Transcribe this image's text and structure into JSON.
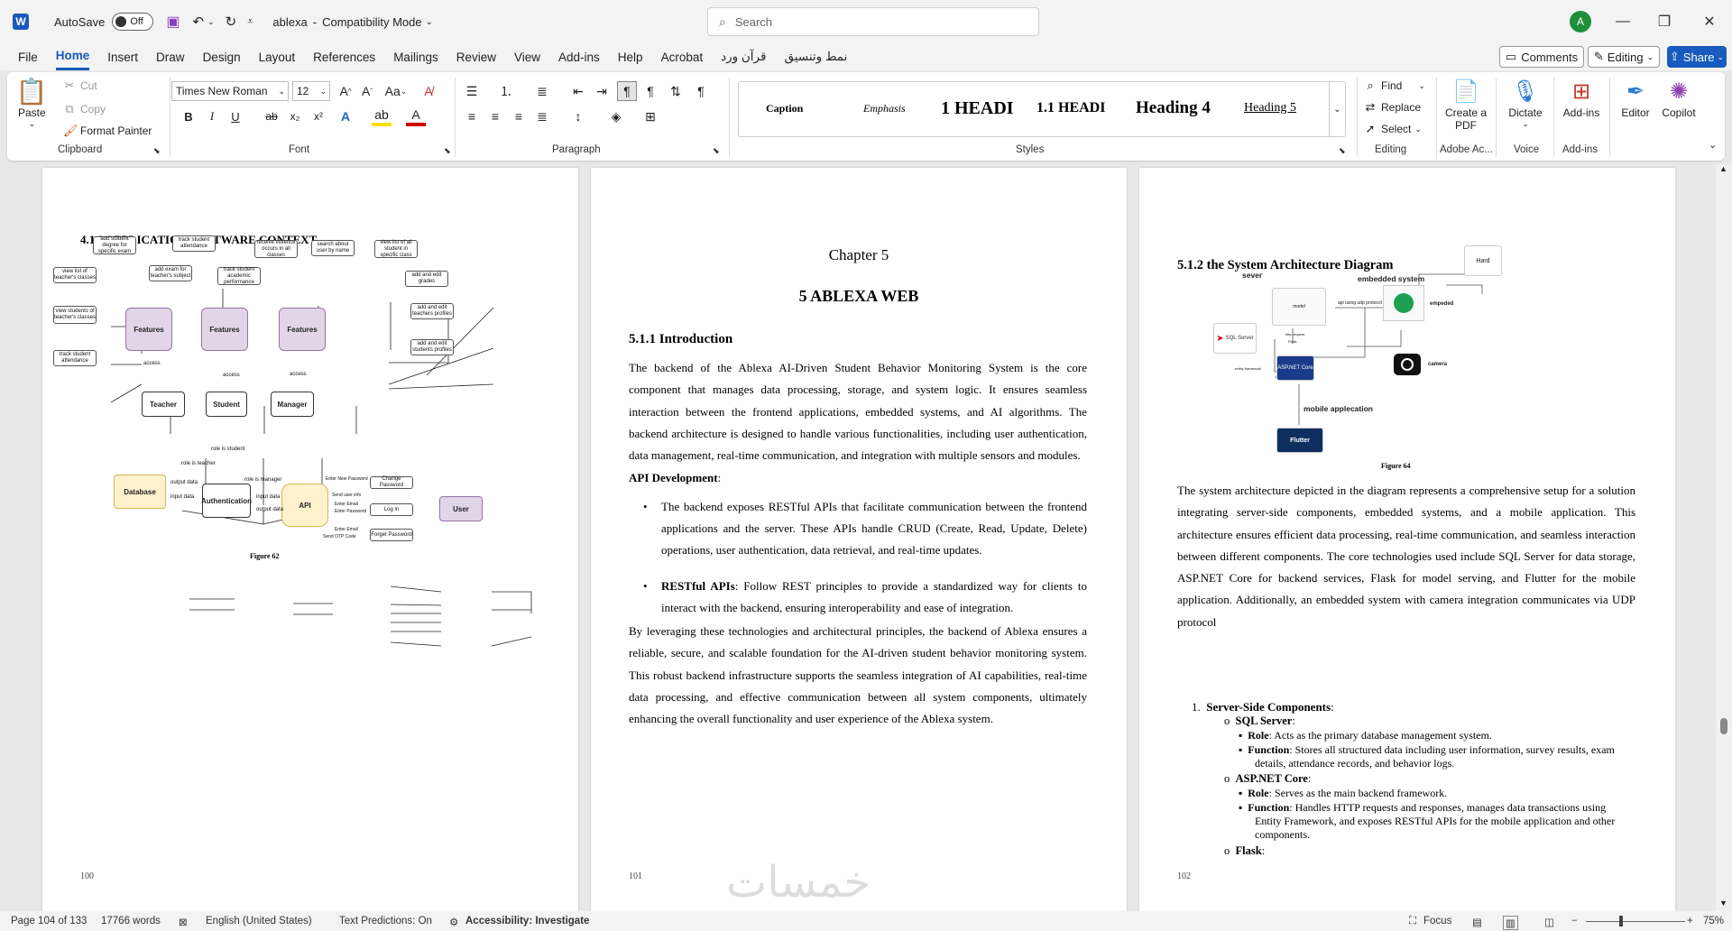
{
  "titlebar": {
    "autosave_label": "AutoSave",
    "autosave_state": "Off",
    "doc_title": "ablexa",
    "mode": "Compatibility Mode",
    "search_placeholder": "Search",
    "user_initial": "A"
  },
  "menu": [
    "File",
    "Home",
    "Insert",
    "Draw",
    "Design",
    "Layout",
    "References",
    "Mailings",
    "Review",
    "View",
    "Add-ins",
    "Help",
    "Acrobat",
    "قرآن ورد",
    "نمط وتنسيق"
  ],
  "actions": {
    "comments": "Comments",
    "editing": "Editing",
    "share": "Share"
  },
  "ribbon": {
    "clipboard": {
      "paste": "Paste",
      "cut": "Cut",
      "copy": "Copy",
      "format_painter": "Format Painter",
      "label": "Clipboard"
    },
    "font": {
      "name": "Times New Roman",
      "size": "12",
      "label": "Font",
      "case": "Aa"
    },
    "paragraph": {
      "label": "Paragraph"
    },
    "styles": {
      "items": [
        "Caption",
        "Emphasis",
        "1  HEADI",
        "1.1  HEADI",
        "Heading 4",
        "Heading 5"
      ],
      "label": "Styles"
    },
    "editing": {
      "find": "Find",
      "replace": "Replace",
      "select": "Select",
      "label": "Editing"
    },
    "adobe": {
      "btn": "Create a PDF",
      "label": "Adobe Ac..."
    },
    "voice": {
      "btn": "Dictate",
      "label": "Voice"
    },
    "addins": {
      "btn": "Add-ins",
      "label": "Add-ins"
    },
    "editor": "Editor",
    "copilot": "Copilot"
  },
  "page1": {
    "heading": "4.1.9 APPLICATION SOFTWARE CONTEXT",
    "caption": "Figure 62",
    "page_number": "100",
    "diagram": {
      "features": "Features",
      "access": "access",
      "teacher": "Teacher",
      "student": "Student",
      "manager": "Manager",
      "database": "Database",
      "auth": "Authentication",
      "api": "API",
      "user": "User",
      "b_add_student_degree": "add  student degree for specific exam",
      "b_track_att1": "track student attendance",
      "b_view_classes": "view list of teacher's classes",
      "b_add_exam": "add exam for teacher's subject",
      "b_view_students": "view students of teacher's classes",
      "b_track_att2": "track student attendance",
      "b_track_perf": "track student academic performance",
      "b_violence": "receive violence occurs in all classes",
      "b_search_user": "search about user by name",
      "b_view_all_students": "view list of all student in specific class",
      "b_grades": "add and edit grades",
      "b_teachers_profiles": "add and edit teachers profiles",
      "b_students_profiles": "add and edit students profiles",
      "change_pw": "Change Password",
      "login": "Log in",
      "forget_pw": "Forget Password",
      "l_role_student": "role is student",
      "l_role_teacher": "role is teacher",
      "l_role_manager": "role is manager",
      "l_output": "output data",
      "l_input": "input data",
      "l_new_pw": "Enter New Password",
      "l_send_info": "Send user info",
      "l_email": "Enter Email",
      "l_password": "Enter Password",
      "l_email2": "Enter Email",
      "l_otp": "Send OTP Code"
    }
  },
  "page2": {
    "chapter": "Chapter 5",
    "title": "5   ABLEXA   WEB",
    "section": "5.1.1  Introduction",
    "intro": "The backend of the Ablexa AI-Driven Student Behavior Monitoring System is the core component that manages data processing, storage, and system logic. It ensures seamless interaction between the frontend applications, embedded systems, and AI algorithms. The backend architecture is designed to handle various functionalities, including user authentication, data management, real-time communication, and integration with multiple sensors and modules.",
    "api_heading": "API Development",
    "bullet1": "The backend exposes RESTful APIs that facilitate communication between the frontend applications and the server. These APIs handle CRUD (Create, Read, Update, Delete) operations, user authentication, data retrieval, and real-time updates.",
    "bullet2_bold": "RESTful APIs",
    "bullet2": ": Follow REST principles to provide a standardized way for clients to interact with the backend, ensuring interoperability and ease of integration.",
    "closing": "By leveraging these technologies and architectural principles, the backend of Ablexa ensures a reliable, secure, and scalable foundation for the AI-driven student behavior monitoring system. This robust backend infrastructure supports the seamless integration of AI capabilities, real-time data processing, and effective communication between all system components, ultimately enhancing the overall functionality and user experience of the Ablexa system.",
    "page_number": "101"
  },
  "page3": {
    "heading": "5.1.2  the System Architecture Diagram",
    "caption": "Figure 64",
    "diagram": {
      "sever": "sever",
      "embedded": "embedded system",
      "hard": "Hard",
      "model": "model",
      "api_udp": "api using udp protocol",
      "empeded": "empeded",
      "sql": "SQL Server",
      "aspnet": "ASP.NET Core",
      "camera": "camera",
      "mobile": "mobile applecation",
      "flutter": "Flutter",
      "entity": "entity framework",
      "http": "http request",
      "flask": "Flask"
    },
    "para": "The system architecture depicted in the diagram represents a comprehensive setup for a solution integrating server-side components, embedded systems, and a mobile application. This architecture ensures efficient data processing, real-time communication, and seamless interaction between different components. The core technologies used include SQL Server for data storage, ASP.NET Core for backend services, Flask for model serving, and Flutter for the mobile application. Additionally, an embedded system with camera integration communicates via UDP protocol",
    "list_title": "Server-Side Components",
    "sql_title": "SQL Server",
    "sql_role": "Acts as the primary database management system.",
    "sql_func": "Stores all structured data including user information, survey results, exam details, attendance records, and behavior logs.",
    "asp_title": "ASP.NET Core",
    "asp_role": "Serves as the main backend framework.",
    "asp_func": "Handles HTTP requests and responses, manages data transactions using Entity Framework, and exposes RESTful APIs for the mobile application and other components.",
    "flask_title": "Flask",
    "role_label": "Role",
    "func_label": "Function",
    "page_number": "102"
  },
  "status": {
    "page": "Page 104 of 133",
    "words": "17766 words",
    "language": "English (United States)",
    "predictions": "Text Predictions: On",
    "accessibility": "Accessibility: Investigate",
    "focus": "Focus",
    "zoom": "75%"
  },
  "watermark": "خمسات"
}
